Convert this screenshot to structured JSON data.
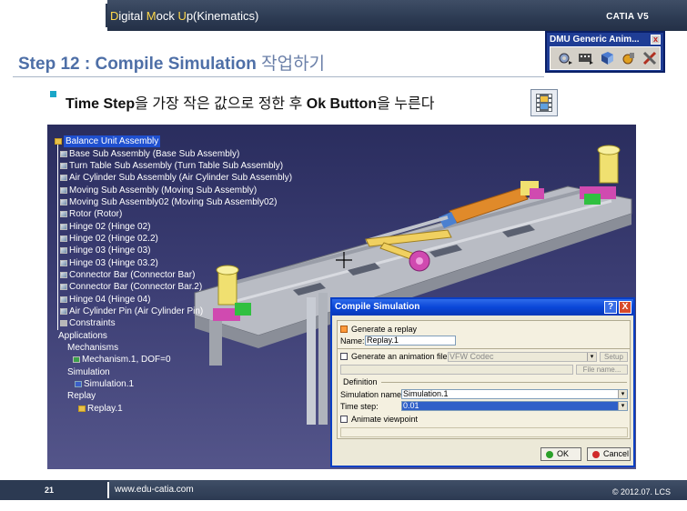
{
  "header": {
    "course_title_parts": [
      "D",
      "igital ",
      "M",
      "ock ",
      "U",
      "p(Kinematics)"
    ],
    "product": "CATIA V5"
  },
  "step": {
    "title": "Step 12 : Compile Simulation",
    "title_kr": "작업하기"
  },
  "toolbar": {
    "title": "DMU Generic Anim...",
    "close_label": "x",
    "buttons": [
      "simulation-icon",
      "compile-simulation-icon",
      "replay-icon",
      "sequence-icon",
      "tools-icon"
    ]
  },
  "instruction": {
    "part1_bold": "Time Step",
    "part2": "을 가장 작은 값으로 정한 후 ",
    "part3_bold": "Ok Button",
    "part4": "을 누른다"
  },
  "tree": {
    "root": "Balance Unit Assembly",
    "items": [
      "Base Sub Assembly (Base Sub Assembly)",
      "Turn Table Sub Assembly (Turn Table Sub Assembly)",
      "Air Cylinder Sub Assembly (Air Cylinder Sub Assembly)",
      "Moving Sub Assembly (Moving Sub Assembly)",
      "Moving Sub Assembly02 (Moving Sub Assembly02)",
      "Rotor (Rotor)",
      "Hinge 02 (Hinge 02)",
      "Hinge 02 (Hinge 02.2)",
      "Hinge 03 (Hinge 03)",
      "Hinge 03 (Hinge 03.2)",
      "Connector Bar (Connector Bar)",
      "Connector Bar (Connector Bar.2)",
      "Hinge 04 (Hinge 04)",
      "Air Cylinder Pin (Air Cylinder Pin)",
      "Constraints",
      "Applications",
      "Mechanisms",
      "Mechanism.1, DOF=0",
      "Simulation",
      "Simulation.1",
      "Replay",
      "Replay.1"
    ]
  },
  "dialog": {
    "title": "Compile Simulation",
    "help_label": "?",
    "close_label": "X",
    "generate_replay_label": "Generate a replay",
    "generate_replay_checked": true,
    "name_label": "Name:",
    "name_value": "Replay.1",
    "generate_animation_label": "Generate an animation file",
    "codec_value": "VFW Codec",
    "setup_label": "Setup",
    "file_name_label": "File name...",
    "definition_label": "Definition",
    "simulation_name_label": "Simulation name:",
    "simulation_name_value": "Simulation.1",
    "time_step_label": "Time step:",
    "time_step_value": "0.01",
    "animate_viewpoint_label": "Animate viewpoint",
    "ok_label": "OK",
    "cancel_label": "Cancel"
  },
  "footer": {
    "page_number": "21",
    "url": "www.edu-catia.com",
    "copyright": "© 2012.07. LCS"
  },
  "colors": {
    "accent_title": "#4e6fa7",
    "header_bg": "#2c3a52",
    "dialog_titlebar": "#0a46d8",
    "selection": "#3060c8"
  }
}
